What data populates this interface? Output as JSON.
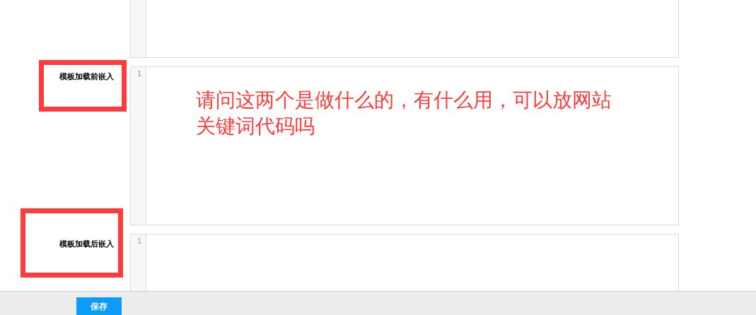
{
  "editors": [
    {
      "label": "模板加载前嵌入",
      "line_numbers": [
        "1"
      ]
    },
    {
      "label": "模板加载后嵌入",
      "line_numbers": [
        "1"
      ]
    }
  ],
  "annotation": {
    "note": "请问这两个是做什么的，有什么用，可以放网站关键词代码吗"
  },
  "footer": {
    "save_button": "保存"
  }
}
